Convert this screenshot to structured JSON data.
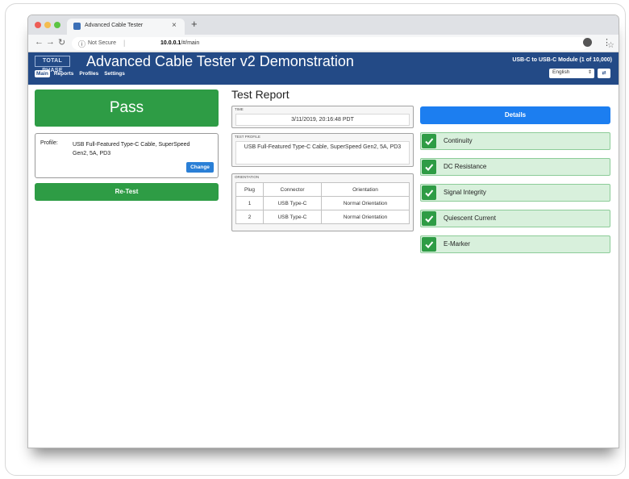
{
  "browser": {
    "tab_title": "Advanced Cable Tester",
    "tab_close": "×",
    "new_tab": "+",
    "security_label": "Not Secure",
    "url_host": "10.0.0.1",
    "url_path": "/#/main"
  },
  "header": {
    "logo_text": "TOTAL PHASE",
    "title": "Advanced Cable Tester v2 Demonstration",
    "module": "USB-C to USB-C Module (1 of 10,000)",
    "nav": [
      "Main",
      "Reports",
      "Profiles",
      "Settings"
    ],
    "language": "English",
    "language_button": "⇄"
  },
  "left": {
    "result": "Pass",
    "profile_label": "Profile:",
    "profile_value": "USB Full-Featured Type-C Cable, SuperSpeed Gen2, 5A, PD3",
    "change_label": "Change",
    "retest_label": "Re-Test"
  },
  "report": {
    "heading": "Test Report",
    "time_label": "Time",
    "time_value": "3/11/2019, 20:16:48 PDT",
    "profile_label": "Test Profile",
    "profile_value": "USB Full-Featured Type-C Cable, SuperSpeed Gen2, 5A, PD3",
    "orientation_label": "Orientation",
    "orientation_headers": [
      "Plug",
      "Connector",
      "Orientation"
    ],
    "orientation_rows": [
      [
        "1",
        "USB Type-C",
        "Normal Orientation"
      ],
      [
        "2",
        "USB Type-C",
        "Normal Orientation"
      ]
    ]
  },
  "details": {
    "button_label": "Details",
    "checks": [
      "Continuity",
      "DC Resistance",
      "Signal Integrity",
      "Quiescent Current",
      "E-Marker"
    ]
  },
  "colors": {
    "header_blue": "#234a86",
    "pass_green": "#2e9c45",
    "details_blue": "#1c7ef0",
    "check_row_green": "#d8f0dc"
  }
}
